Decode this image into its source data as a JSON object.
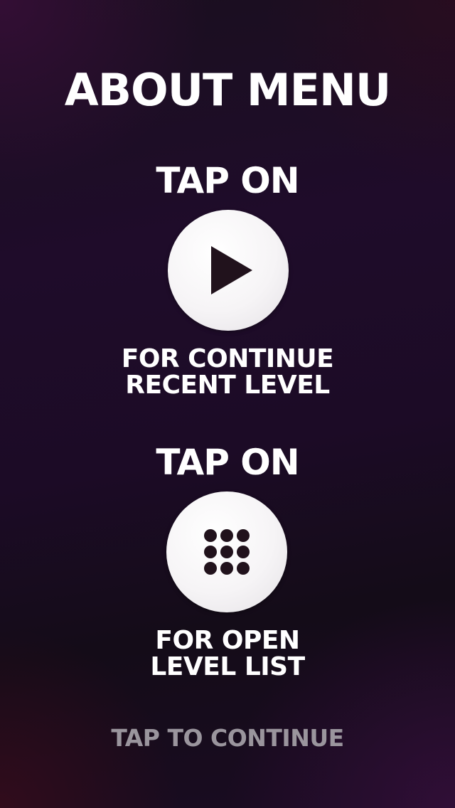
{
  "screen": {
    "title": "ABOUT MENU"
  },
  "sections": [
    {
      "prompt": "TAP ON",
      "button_icon": "play-icon",
      "description_line1": "FOR CONTINUE",
      "description_line2": "RECENT LEVEL"
    },
    {
      "prompt": "TAP ON",
      "button_icon": "level-grid-icon",
      "description_line1": "FOR OPEN",
      "description_line2": "LEVEL LIST"
    }
  ],
  "footer": {
    "continue_label": "TAP TO CONTINUE"
  },
  "colors": {
    "text": "#ffffff",
    "muted_text": "#9a959d",
    "button_face": "#f6f4f6",
    "icon": "#21121c",
    "background": "#1c0b26"
  }
}
